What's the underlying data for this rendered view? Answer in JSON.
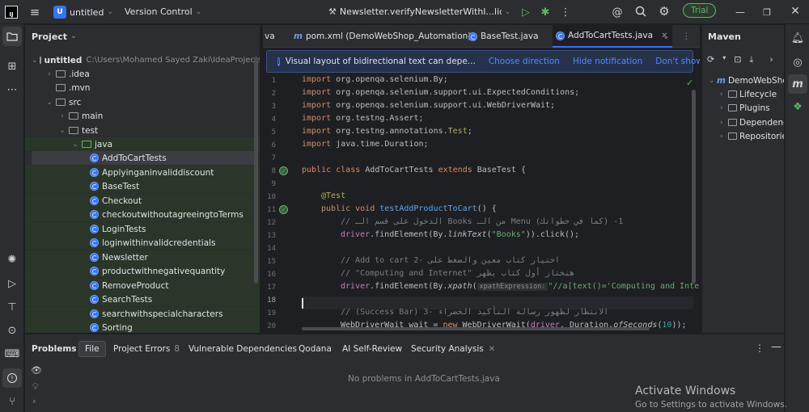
{
  "topbar": {
    "logo": "IJ",
    "project_badge": "U",
    "project_name": "untitled",
    "vcs": "Version Control",
    "run_config": "Newsletter.verifyNewsletterWithI...lidEmail",
    "trial": "Trial"
  },
  "project_panel": {
    "title": "Project",
    "root_name": "untitled",
    "root_path": "C:\\Users\\Mohamed Sayed Zaki\\IdeaProjects\\u",
    "items": [
      {
        "label": "untitled"
      },
      {
        "label": ".idea"
      },
      {
        "label": ".mvn"
      },
      {
        "label": "src"
      },
      {
        "label": "main"
      },
      {
        "label": "test"
      },
      {
        "label": "java"
      },
      {
        "label": "AddToCartTests"
      },
      {
        "label": "Applyinganinvaliddiscount"
      },
      {
        "label": "BaseTest"
      },
      {
        "label": "Checkout"
      },
      {
        "label": "checkoutwithoutagreeingtoTerms"
      },
      {
        "label": "LoginTests"
      },
      {
        "label": "loginwithinvalidcredentials"
      },
      {
        "label": "Newsletter"
      },
      {
        "label": "productwithnegativequantity"
      },
      {
        "label": "RemoveProduct"
      },
      {
        "label": "SearchTests"
      },
      {
        "label": "searchwithspecialcharacters"
      },
      {
        "label": "Sorting"
      }
    ]
  },
  "editor": {
    "tabs": [
      {
        "label": "va"
      },
      {
        "label": "pom.xml (DemoWebShop_Automation)"
      },
      {
        "label": "BaseTest.java"
      },
      {
        "label": "AddToCartTests.java"
      }
    ],
    "notification": {
      "message": "Visual layout of bidirectional text can depe...",
      "choose": "Choose direction",
      "hide": "Hide notification",
      "dont_show": "Don't show again"
    },
    "line_numbers": [
      "1",
      "2",
      "3",
      "4",
      "5",
      "6",
      "7",
      "8",
      "9",
      "10",
      "11",
      "12",
      "13",
      "14",
      "15",
      "16",
      "17",
      "18",
      "19",
      "20"
    ],
    "lines": {
      "l1a": "import ",
      "l1b": "org.openqa.selenium.By;",
      "l2a": "import ",
      "l2b": "org.openqa.selenium.support.ui.ExpectedConditions;",
      "l3a": "import ",
      "l3b": "org.openqa.selenium.support.ui.WebDriverWait;",
      "l4a": "import ",
      "l4b": "org.testng.Assert;",
      "l5a": "import ",
      "l5b": "org.testng.annotations.",
      "l5c": "Test",
      "l5d": ";",
      "l6a": "import ",
      "l6b": "java.time.Duration;",
      "l8a": "public class ",
      "l8b": "AddToCartTests ",
      "l8c": "extends ",
      "l8d": "BaseTest {",
      "l10": "@Test",
      "l11a": "public void ",
      "l11b": "testAddProductToCart",
      "l11c": "() {",
      "l12": "// الدخول على قسم الـ Books من الـ Menu (كما في خطواتك) -1",
      "l13a": "driver",
      "l13b": ".findElement(By.",
      "l13c": "linkText",
      "l13d": "(",
      "l13e": "\"Books\"",
      "l13f": ")).click();",
      "l15": "// Add to cart اختيار كتاب معين والضغط على -2",
      "l16": "// \"Computing and Internet\" هنختار أول كتاب يظهر",
      "l17a": "driver",
      "l17b": ".findElement(By.",
      "l17c": "xpath",
      "l17d": "(",
      "l17hint": "xpathExpression:",
      "l17e": "\"//a[text()='Computing and Interne",
      "l19": "// (Success Bar) الانتظار لظهور رسالة التأكيد الخضراء -3",
      "l20a": "WebDriverWait wait = ",
      "l20b": "new ",
      "l20c": "WebDriverWait(",
      "l20d": "driver",
      "l20e": ", Duration.",
      "l20f": "ofSeconds",
      "l20g": "(",
      "l20h": "10",
      "l20i": "));"
    }
  },
  "maven": {
    "title": "Maven",
    "items": [
      {
        "label": "DemoWebSho"
      },
      {
        "label": "Lifecycle"
      },
      {
        "label": "Plugins"
      },
      {
        "label": "Dependenc"
      },
      {
        "label": "Repositorie"
      }
    ]
  },
  "bottom": {
    "tabs": [
      {
        "label": "Problems"
      },
      {
        "label": "File"
      },
      {
        "label": "Project Errors"
      },
      {
        "label": "8"
      },
      {
        "label": "Vulnerable Dependencies"
      },
      {
        "label": "Qodana"
      },
      {
        "label": "AI Self-Review"
      },
      {
        "label": "Security Analysis"
      }
    ],
    "empty_message": "No problems in AddToCartTests.java"
  },
  "watermark": {
    "line1": "Activate Windows",
    "line2": "Go to Settings to activate Windows."
  },
  "colors": {
    "accent": "#3574f0",
    "background": "#1e1f22",
    "panel": "#2b2d30",
    "trial_green": "#5fb865"
  }
}
